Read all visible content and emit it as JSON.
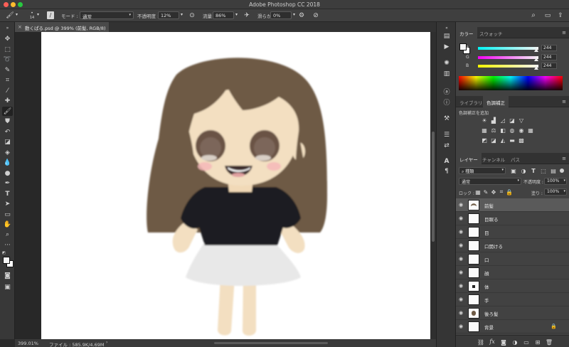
{
  "app": {
    "title": "Adobe Photoshop CC 2018"
  },
  "options_bar": {
    "brush_size": "14",
    "mode_label": "モード :",
    "mode_value": "通常",
    "opacity_label": "不透明度 :",
    "opacity_value": "12%",
    "flow_label": "流量 :",
    "flow_value": "86%",
    "smoothing_label": "滑らかさ :",
    "smoothing_value": "0%"
  },
  "document": {
    "tab_title": "動くぱる.psd @ 399% (前髪, RGB/8)",
    "zoom": "399.01%",
    "file_info": "ファイル : 585.9K/4.69M"
  },
  "color_panel": {
    "tabs": [
      "カラー",
      "スウォッチ"
    ],
    "channels": [
      {
        "label": "R",
        "value": "244"
      },
      {
        "label": "G",
        "value": "244"
      },
      {
        "label": "B",
        "value": "244"
      }
    ]
  },
  "adjust_panel": {
    "tabs": [
      "ライブラリ",
      "色調補正"
    ],
    "add_label": "色調補正を追加"
  },
  "layers_panel": {
    "tabs": [
      "レイヤー",
      "チャンネル",
      "パス"
    ],
    "filter_kind": "種類",
    "blend_mode": "通常",
    "opacity_label": "不透明度 :",
    "opacity_value": "100%",
    "lock_label": "ロック :",
    "fill_label": "塗り :",
    "fill_value": "100%",
    "layers": [
      {
        "name": "前髪",
        "selected": true
      },
      {
        "name": "目瞑る",
        "selected": false
      },
      {
        "name": "目",
        "selected": false
      },
      {
        "name": "口開ける",
        "selected": false
      },
      {
        "name": "口",
        "selected": false
      },
      {
        "name": "顔",
        "selected": false
      },
      {
        "name": "体",
        "selected": false
      },
      {
        "name": "手",
        "selected": false
      },
      {
        "name": "後ろ髪",
        "selected": false
      },
      {
        "name": "背景",
        "selected": false
      }
    ],
    "footer_fx": "fx"
  },
  "colors": {
    "hair": "#6e5a44",
    "skin": "#f3dfc1",
    "shirt": "#1f1f21",
    "skirt": "#e8e8e8",
    "cheek": "#f4b8b8"
  }
}
